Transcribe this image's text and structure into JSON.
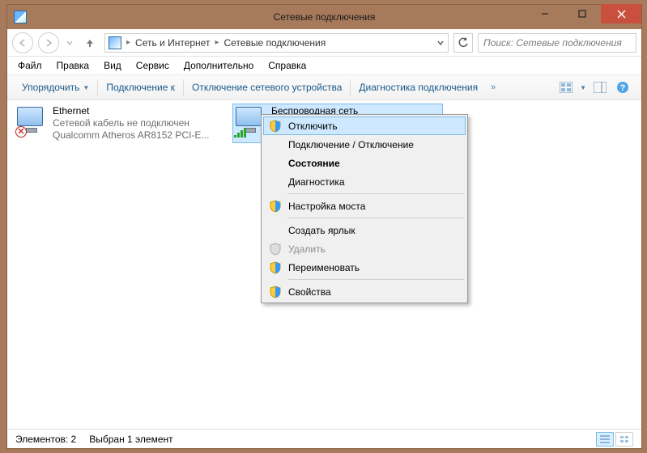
{
  "window": {
    "title": "Сетевые подключения"
  },
  "breadcrumbs": {
    "network": "Сеть и Интернет",
    "connections": "Сетевые подключения"
  },
  "search": {
    "placeholder": "Поиск: Сетевые подключения"
  },
  "menu": {
    "file": "Файл",
    "edit": "Правка",
    "view": "Вид",
    "tools": "Сервис",
    "extra": "Дополнительно",
    "help": "Справка"
  },
  "toolbar": {
    "organize": "Упорядочить",
    "connect_to": "Подключение к",
    "disable_device": "Отключение сетевого устройства",
    "diagnose": "Диагностика подключения"
  },
  "items": {
    "ethernet": {
      "name": "Ethernet",
      "status": "Сетевой кабель не подключен",
      "adapter": "Qualcomm Atheros AR8152 PCI-E..."
    },
    "wifi": {
      "name": "Беспроводная сеть"
    }
  },
  "context": {
    "disable": "Отключить",
    "connect_disconnect": "Подключение / Отключение",
    "status": "Состояние",
    "diagnostics": "Диагностика",
    "bridge": "Настройка моста",
    "shortcut": "Создать ярлык",
    "delete": "Удалить",
    "rename": "Переименовать",
    "properties": "Свойства"
  },
  "status": {
    "count": "Элементов: 2",
    "selected": "Выбран 1 элемент"
  }
}
